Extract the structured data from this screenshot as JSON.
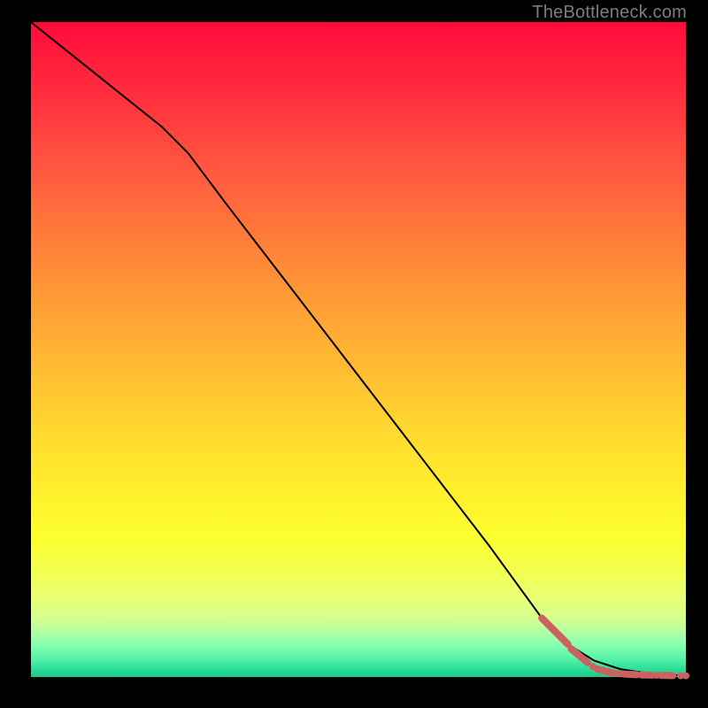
{
  "attribution": "TheBottleneck.com",
  "colors": {
    "background": "#000000",
    "curve": "#000000",
    "marker": "#cb6161",
    "attribution_text": "#7d7d7d"
  },
  "chart_data": {
    "type": "line",
    "title": "",
    "xlabel": "",
    "ylabel": "",
    "xlim": [
      0,
      100
    ],
    "ylim": [
      0,
      100
    ],
    "series": [
      {
        "name": "main-curve",
        "x": [
          0,
          10,
          20,
          24,
          30,
          40,
          50,
          60,
          70,
          78,
          82,
          86,
          90,
          94,
          98,
          100
        ],
        "y": [
          100,
          92,
          84,
          80,
          72,
          59,
          46,
          33,
          20,
          9,
          5,
          2.5,
          1.2,
          0.6,
          0.3,
          0.2
        ]
      }
    ],
    "markers": [
      {
        "shape": "segment",
        "x0": 78.0,
        "y0": 9.0,
        "x1": 82.0,
        "y1": 5.0
      },
      {
        "shape": "segment",
        "x0": 82.5,
        "y0": 4.3,
        "x1": 85.0,
        "y1": 2.2
      },
      {
        "shape": "dot",
        "x": 85.8,
        "y": 1.6
      },
      {
        "shape": "segment",
        "x0": 86.5,
        "y0": 1.2,
        "x1": 89.0,
        "y1": 0.6
      },
      {
        "shape": "dot",
        "x": 89.8,
        "y": 0.5
      },
      {
        "shape": "segment",
        "x0": 90.5,
        "y0": 0.45,
        "x1": 92.5,
        "y1": 0.35
      },
      {
        "shape": "segment",
        "x0": 93.2,
        "y0": 0.32,
        "x1": 94.8,
        "y1": 0.28
      },
      {
        "shape": "dot",
        "x": 95.5,
        "y": 0.26
      },
      {
        "shape": "segment",
        "x0": 96.2,
        "y0": 0.25,
        "x1": 98.0,
        "y1": 0.22
      },
      {
        "shape": "dot",
        "x": 99.2,
        "y": 0.21
      },
      {
        "shape": "dot",
        "x": 100.0,
        "y": 0.2
      }
    ]
  }
}
